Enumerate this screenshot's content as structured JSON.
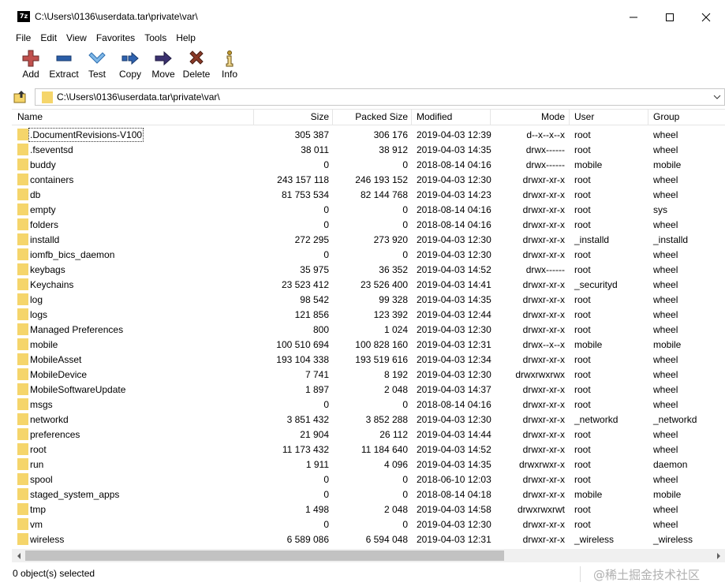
{
  "window": {
    "app_icon_text": "7z",
    "title": "C:\\Users\\0136\\userdata.tar\\private\\var\\"
  },
  "menu": [
    "File",
    "Edit",
    "View",
    "Favorites",
    "Tools",
    "Help"
  ],
  "toolbar": [
    {
      "label": "Add",
      "icon": "add-icon"
    },
    {
      "label": "Extract",
      "icon": "extract-icon"
    },
    {
      "label": "Test",
      "icon": "test-icon"
    },
    {
      "label": "Copy",
      "icon": "copy-icon"
    },
    {
      "label": "Move",
      "icon": "move-icon"
    },
    {
      "label": "Delete",
      "icon": "delete-icon"
    },
    {
      "label": "Info",
      "icon": "info-icon"
    }
  ],
  "address": {
    "path": "C:\\Users\\0136\\userdata.tar\\private\\var\\"
  },
  "columns": {
    "name": "Name",
    "size": "Size",
    "packed": "Packed Size",
    "modified": "Modified",
    "mode": "Mode",
    "user": "User",
    "group": "Group"
  },
  "files": [
    {
      "name": ".DocumentRevisions-V100",
      "size": "305 387",
      "packed": "306 176",
      "modified": "2019-04-03 12:39",
      "mode": "d--x--x--x",
      "user": "root",
      "group": "wheel"
    },
    {
      "name": ".fseventsd",
      "size": "38 011",
      "packed": "38 912",
      "modified": "2019-04-03 14:35",
      "mode": "drwx------",
      "user": "root",
      "group": "wheel"
    },
    {
      "name": "buddy",
      "size": "0",
      "packed": "0",
      "modified": "2018-08-14 04:16",
      "mode": "drwx------",
      "user": "mobile",
      "group": "mobile"
    },
    {
      "name": "containers",
      "size": "243 157 118",
      "packed": "246 193 152",
      "modified": "2019-04-03 12:30",
      "mode": "drwxr-xr-x",
      "user": "root",
      "group": "wheel"
    },
    {
      "name": "db",
      "size": "81 753 534",
      "packed": "82 144 768",
      "modified": "2019-04-03 14:23",
      "mode": "drwxr-xr-x",
      "user": "root",
      "group": "wheel"
    },
    {
      "name": "empty",
      "size": "0",
      "packed": "0",
      "modified": "2018-08-14 04:16",
      "mode": "drwxr-xr-x",
      "user": "root",
      "group": "sys"
    },
    {
      "name": "folders",
      "size": "0",
      "packed": "0",
      "modified": "2018-08-14 04:16",
      "mode": "drwxr-xr-x",
      "user": "root",
      "group": "wheel"
    },
    {
      "name": "installd",
      "size": "272 295",
      "packed": "273 920",
      "modified": "2019-04-03 12:30",
      "mode": "drwxr-xr-x",
      "user": "_installd",
      "group": "_installd"
    },
    {
      "name": "iomfb_bics_daemon",
      "size": "0",
      "packed": "0",
      "modified": "2019-04-03 12:30",
      "mode": "drwxr-xr-x",
      "user": "root",
      "group": "wheel"
    },
    {
      "name": "keybags",
      "size": "35 975",
      "packed": "36 352",
      "modified": "2019-04-03 14:52",
      "mode": "drwx------",
      "user": "root",
      "group": "wheel"
    },
    {
      "name": "Keychains",
      "size": "23 523 412",
      "packed": "23 526 400",
      "modified": "2019-04-03 14:41",
      "mode": "drwxr-xr-x",
      "user": "_securityd",
      "group": "wheel"
    },
    {
      "name": "log",
      "size": "98 542",
      "packed": "99 328",
      "modified": "2019-04-03 14:35",
      "mode": "drwxr-xr-x",
      "user": "root",
      "group": "wheel"
    },
    {
      "name": "logs",
      "size": "121 856",
      "packed": "123 392",
      "modified": "2019-04-03 12:44",
      "mode": "drwxr-xr-x",
      "user": "root",
      "group": "wheel"
    },
    {
      "name": "Managed Preferences",
      "size": "800",
      "packed": "1 024",
      "modified": "2019-04-03 12:30",
      "mode": "drwxr-xr-x",
      "user": "root",
      "group": "wheel"
    },
    {
      "name": "mobile",
      "size": "100 510 694",
      "packed": "100 828 160",
      "modified": "2019-04-03 12:31",
      "mode": "drwx--x--x",
      "user": "mobile",
      "group": "mobile"
    },
    {
      "name": "MobileAsset",
      "size": "193 104 338",
      "packed": "193 519 616",
      "modified": "2019-04-03 12:34",
      "mode": "drwxr-xr-x",
      "user": "root",
      "group": "wheel"
    },
    {
      "name": "MobileDevice",
      "size": "7 741",
      "packed": "8 192",
      "modified": "2019-04-03 12:30",
      "mode": "drwxrwxrwx",
      "user": "root",
      "group": "wheel"
    },
    {
      "name": "MobileSoftwareUpdate",
      "size": "1 897",
      "packed": "2 048",
      "modified": "2019-04-03 14:37",
      "mode": "drwxr-xr-x",
      "user": "root",
      "group": "wheel"
    },
    {
      "name": "msgs",
      "size": "0",
      "packed": "0",
      "modified": "2018-08-14 04:16",
      "mode": "drwxr-xr-x",
      "user": "root",
      "group": "wheel"
    },
    {
      "name": "networkd",
      "size": "3 851 432",
      "packed": "3 852 288",
      "modified": "2019-04-03 12:30",
      "mode": "drwxr-xr-x",
      "user": "_networkd",
      "group": "_networkd"
    },
    {
      "name": "preferences",
      "size": "21 904",
      "packed": "26 112",
      "modified": "2019-04-03 14:44",
      "mode": "drwxr-xr-x",
      "user": "root",
      "group": "wheel"
    },
    {
      "name": "root",
      "size": "11 173 432",
      "packed": "11 184 640",
      "modified": "2019-04-03 14:52",
      "mode": "drwxr-xr-x",
      "user": "root",
      "group": "wheel"
    },
    {
      "name": "run",
      "size": "1 911",
      "packed": "4 096",
      "modified": "2019-04-03 14:35",
      "mode": "drwxrwxr-x",
      "user": "root",
      "group": "daemon"
    },
    {
      "name": "spool",
      "size": "0",
      "packed": "0",
      "modified": "2018-06-10 12:03",
      "mode": "drwxr-xr-x",
      "user": "root",
      "group": "wheel"
    },
    {
      "name": "staged_system_apps",
      "size": "0",
      "packed": "0",
      "modified": "2018-08-14 04:18",
      "mode": "drwxr-xr-x",
      "user": "mobile",
      "group": "mobile"
    },
    {
      "name": "tmp",
      "size": "1 498",
      "packed": "2 048",
      "modified": "2019-04-03 14:58",
      "mode": "drwxrwxrwt",
      "user": "root",
      "group": "wheel"
    },
    {
      "name": "vm",
      "size": "0",
      "packed": "0",
      "modified": "2019-04-03 12:30",
      "mode": "drwxr-xr-x",
      "user": "root",
      "group": "wheel"
    },
    {
      "name": "wireless",
      "size": "6 589 086",
      "packed": "6 594 048",
      "modified": "2019-04-03 12:31",
      "mode": "drwxr-xr-x",
      "user": "_wireless",
      "group": "_wireless"
    }
  ],
  "status": {
    "selection": "0 object(s) selected",
    "watermark": "@稀土掘金技术社区"
  },
  "colors": {
    "folder": "#f5d56b",
    "add": "#c0504d",
    "extract": "#2a5ea8",
    "test": "#3f87c8",
    "copy": "#2f63b0",
    "move": "#3b3170",
    "delete": "#8a3a28",
    "info": "#c09a30"
  }
}
